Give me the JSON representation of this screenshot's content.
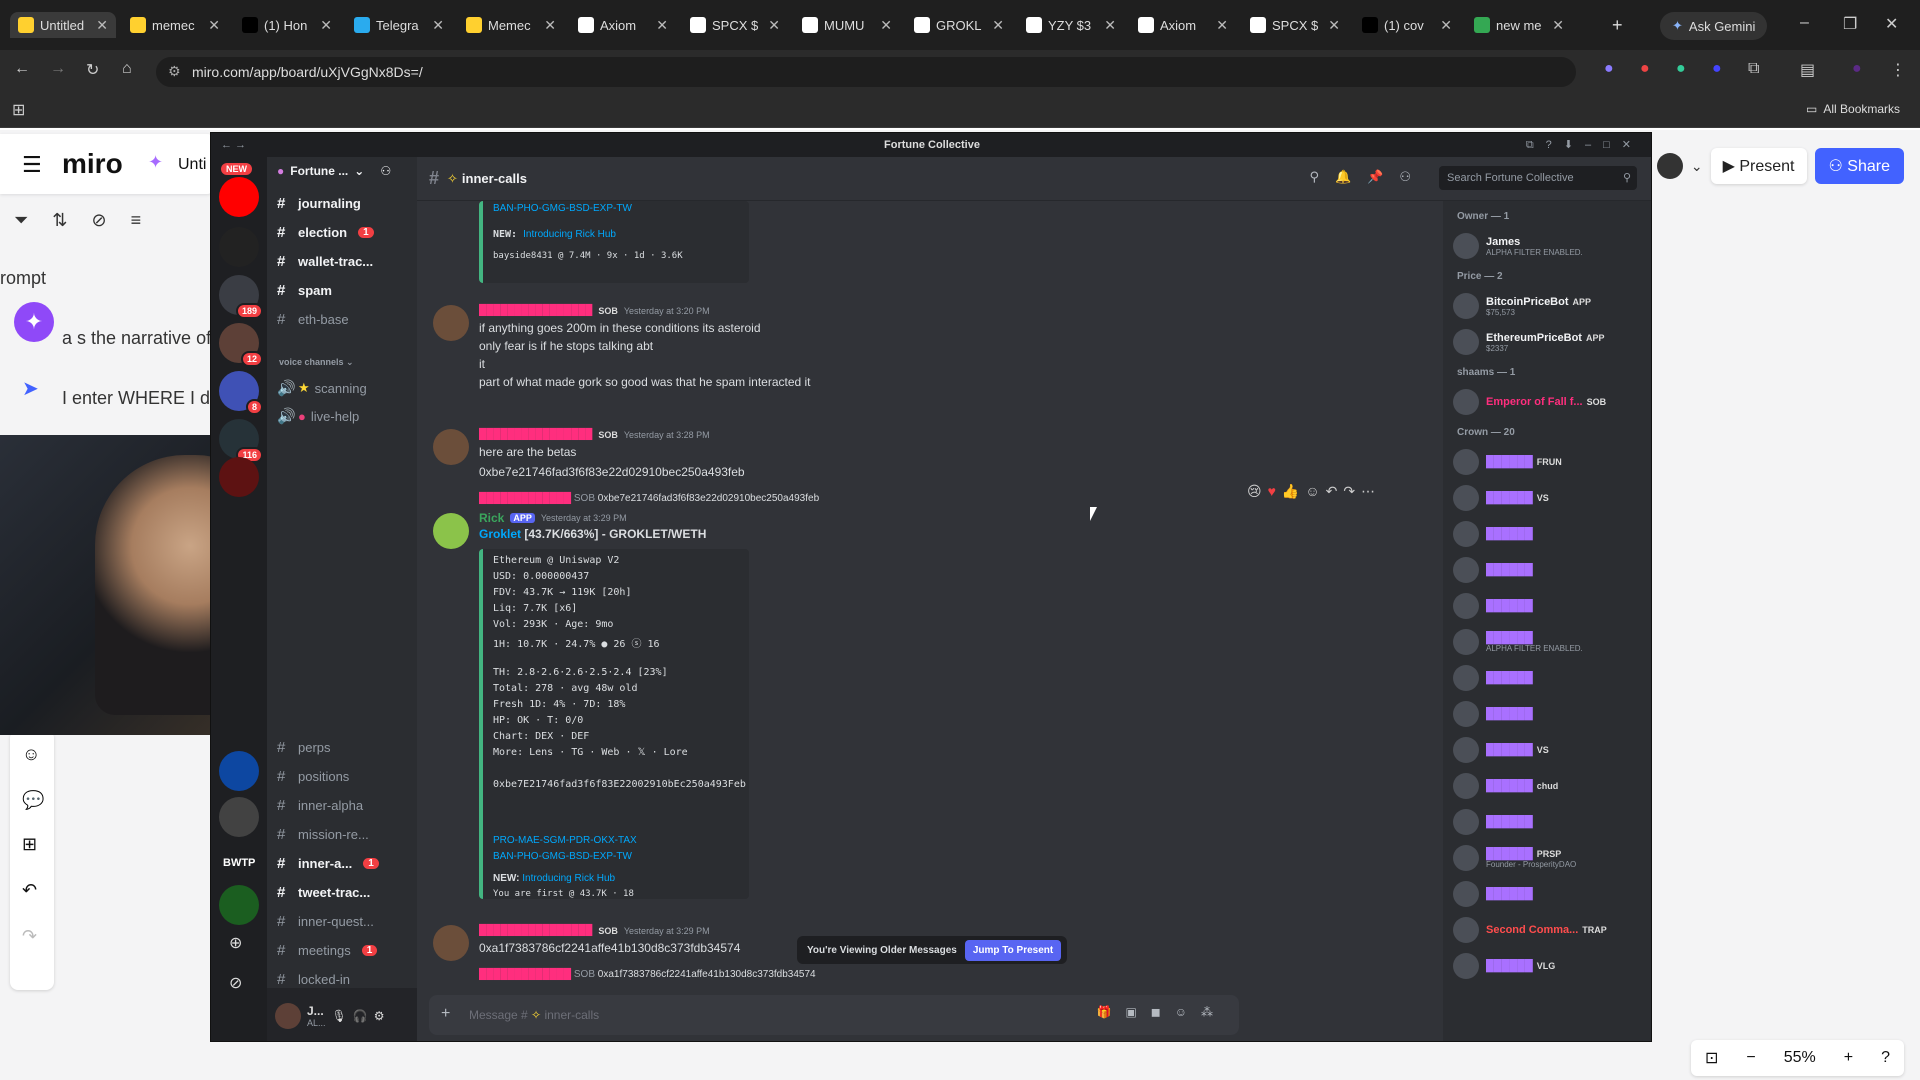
{
  "browser": {
    "tabs": [
      {
        "label": "Untitled",
        "icon": "miro-icon",
        "color": "#ffd02f"
      },
      {
        "label": "memec",
        "icon": "miro-icon",
        "color": "#ffd02f"
      },
      {
        "label": "(1) Hon",
        "icon": "x-icon",
        "color": "#000000"
      },
      {
        "label": "Telegra",
        "icon": "telegram-icon",
        "color": "#2aabee"
      },
      {
        "label": "Memec",
        "icon": "miro-icon",
        "color": "#ffd02f"
      },
      {
        "label": "Axiom",
        "icon": "axiom-icon",
        "color": "#ffffff"
      },
      {
        "label": "SPCX $",
        "icon": "dex-icon",
        "color": "#ffffff"
      },
      {
        "label": "MUMU",
        "icon": "dex-icon",
        "color": "#ffffff"
      },
      {
        "label": "GROKL",
        "icon": "dex-icon",
        "color": "#ffffff"
      },
      {
        "label": "YZY $3",
        "icon": "dex-icon",
        "color": "#ffffff"
      },
      {
        "label": "Axiom",
        "icon": "axiom-icon",
        "color": "#ffffff"
      },
      {
        "label": "SPCX $",
        "icon": "dex-icon",
        "color": "#ffffff"
      },
      {
        "label": "(1) cov",
        "icon": "x-icon",
        "color": "#000000"
      },
      {
        "label": "new me",
        "icon": "google-drive-icon",
        "color": "#34a853"
      }
    ],
    "ask_gemini": "Ask Gemini",
    "url": "miro.com/app/board/uXjVGgNx8Ds=/",
    "all_bookmarks": "All Bookmarks"
  },
  "miro": {
    "logo": "miro",
    "board_name": "Unti",
    "prompt_text": "rompt",
    "narrative_text": "a   s the narrative of..",
    "enter_text": "I enter WHERE I di",
    "present_label": "Present",
    "share_label": "Share",
    "zoom": "55%"
  },
  "discord": {
    "window_title": "Fortune Collective",
    "server_name": "Fortune ...",
    "new_badge": "NEW",
    "channel_header": "inner-calls",
    "search_placeholder": "Search Fortune Collective",
    "channels": [
      {
        "name": "journaling",
        "bold": true,
        "badge": ""
      },
      {
        "name": "election",
        "bold": true,
        "badge": "1"
      },
      {
        "name": "wallet-trac...",
        "bold": true,
        "badge": ""
      },
      {
        "name": "spam",
        "bold": true,
        "badge": ""
      },
      {
        "name": "eth-base",
        "bold": false,
        "badge": ""
      }
    ],
    "voice_category": "voice channels",
    "voice_channels": [
      "scanning",
      "live-help"
    ],
    "lower_channels": [
      {
        "name": "perps",
        "bold": false,
        "badge": ""
      },
      {
        "name": "positions",
        "bold": false,
        "badge": ""
      },
      {
        "name": "inner-alpha",
        "bold": false,
        "badge": ""
      },
      {
        "name": "mission-re...",
        "bold": false,
        "badge": ""
      },
      {
        "name": "inner-a...",
        "bold": true,
        "badge": "1"
      },
      {
        "name": "tweet-trac...",
        "bold": true,
        "badge": ""
      },
      {
        "name": "inner-quest...",
        "bold": false,
        "badge": ""
      },
      {
        "name": "meetings",
        "bold": false,
        "badge": "1"
      },
      {
        "name": "locked-in",
        "bold": false,
        "badge": ""
      }
    ],
    "guild_badges": [
      "189",
      "12",
      "8",
      "116"
    ],
    "guild_text": "BWTP",
    "user": {
      "name": "J...",
      "status": "AL..."
    },
    "messages": {
      "top_embed": {
        "link1": "BAN-PHO-GMG-BSD-EXP-TW",
        "new_label": "NEW:",
        "new_link": "Introducing Rick Hub",
        "footer": "bayside8431 @ 7.4M · 9x · 1d · 3.6K"
      },
      "m1": {
        "tag": "SOB",
        "time": "Yesterday at 3:20 PM",
        "lines": [
          "if anything goes 200m in these conditions its asteroid",
          "only fear is if he stops talking abt",
          "it",
          "part of what made gork so good was that he spam interacted it"
        ]
      },
      "m2": {
        "tag": "SOB",
        "time": "Yesterday at 3:28 PM",
        "lines": [
          "here are the betas",
          "0xbe7e21746fad3f6f83e22d02910bec250a493feb"
        ]
      },
      "rick": {
        "reply_tag": "SOB",
        "reply_text": "0xbe7e21746fad3f6f83e22d02910bec250a493feb",
        "name": "Rick",
        "app": "APP",
        "time": "Yesterday at 3:29 PM",
        "title_link": "Groklet",
        "title": "[43.7K/663%] - GROKLET/WETH",
        "embed_lines": [
          "Ethereum @ Uniswap V2",
          "USD: 0.000000437",
          "FDV: 43.7K → 119K [20h]",
          "Liq: 7.7K [x6]",
          "Vol: 293K · Age: 9mo",
          "1H: 10.7K · 24.7% ● 26 ⓢ 16",
          "",
          "TH: 2.8·2.6·2.6·2.5·2.4 [23%]",
          "Total: 278 · avg 48w old",
          "Fresh 1D: 4% · 7D: 18%",
          "HP: OK · T: 0/0",
          "Chart: DEX · DEF",
          "More: Lens · TG · Web · 𝕏 · Lore",
          "",
          "0xbe7E21746fad3f6f83E22002910bEc250a493Feb"
        ],
        "links2": "PRO-MAE-SGM-PDR-OKX-TAX",
        "links3": "BAN-PHO-GMG-BSD-EXP-TW",
        "new_label": "NEW:",
        "new_link": "Introducing Rick Hub",
        "footer": "You are first @ 43.7K · 18"
      },
      "m3": {
        "tag": "SOB",
        "time": "Yesterday at 3:29 PM",
        "lines": [
          "0xa1f7383786cf2241affe41b130d8c373fdb34574"
        ]
      },
      "m3_reply": {
        "tag": "SOB",
        "text": "0xa1f7383786cf2241affe41b130d8c373fdb34574"
      }
    },
    "older_notice": "You're Viewing Older Messages",
    "jump_label": "Jump To Present",
    "composer_placeholder": "Message #",
    "composer_channel": "inner-calls",
    "members": {
      "owner_header": "Owner — 1",
      "owner": {
        "name": "James",
        "status": "ALPHA FILTER ENABLED."
      },
      "price_header": "Price — 2",
      "price": [
        {
          "name": "BitcoinPriceBot",
          "tag": "APP",
          "status": "$75,573"
        },
        {
          "name": "EthereumPriceBot",
          "tag": "APP",
          "status": "$2337"
        }
      ],
      "shaams_header": "shaams — 1",
      "shaams": {
        "name": "Emperor of Fall f...",
        "tag": "SOB"
      },
      "crown_header": "Crown — 20",
      "crown": [
        {
          "name": "",
          "tag": "FRUN",
          "status": ""
        },
        {
          "name": "",
          "tag": "VS",
          "status": ""
        },
        {
          "name": "",
          "tag": "",
          "status": ""
        },
        {
          "name": "",
          "tag": "",
          "status": ""
        },
        {
          "name": "",
          "tag": "",
          "status": ""
        },
        {
          "name": "",
          "tag": "",
          "status": "ALPHA FILTER ENABLED."
        },
        {
          "name": "",
          "tag": "",
          "status": ""
        },
        {
          "name": "",
          "tag": "",
          "status": ""
        },
        {
          "name": "",
          "tag": "VS",
          "status": ""
        },
        {
          "name": "",
          "tag": "chud",
          "status": ""
        },
        {
          "name": "",
          "tag": "",
          "status": ""
        },
        {
          "name": "",
          "tag": "PRSP",
          "status": "Founder - ProsperityDAO"
        },
        {
          "name": "",
          "tag": "",
          "status": ""
        },
        {
          "name": "Second Comma...",
          "tag": "TRAP",
          "status": ""
        },
        {
          "name": "",
          "tag": "VLG",
          "status": ""
        }
      ]
    }
  },
  "colors": {
    "discord_bg": "#313338",
    "accent": "#5865f2",
    "miro_share": "#4262ff",
    "sob_name": "#ff2e7e",
    "rick_name": "#3ba55d"
  }
}
